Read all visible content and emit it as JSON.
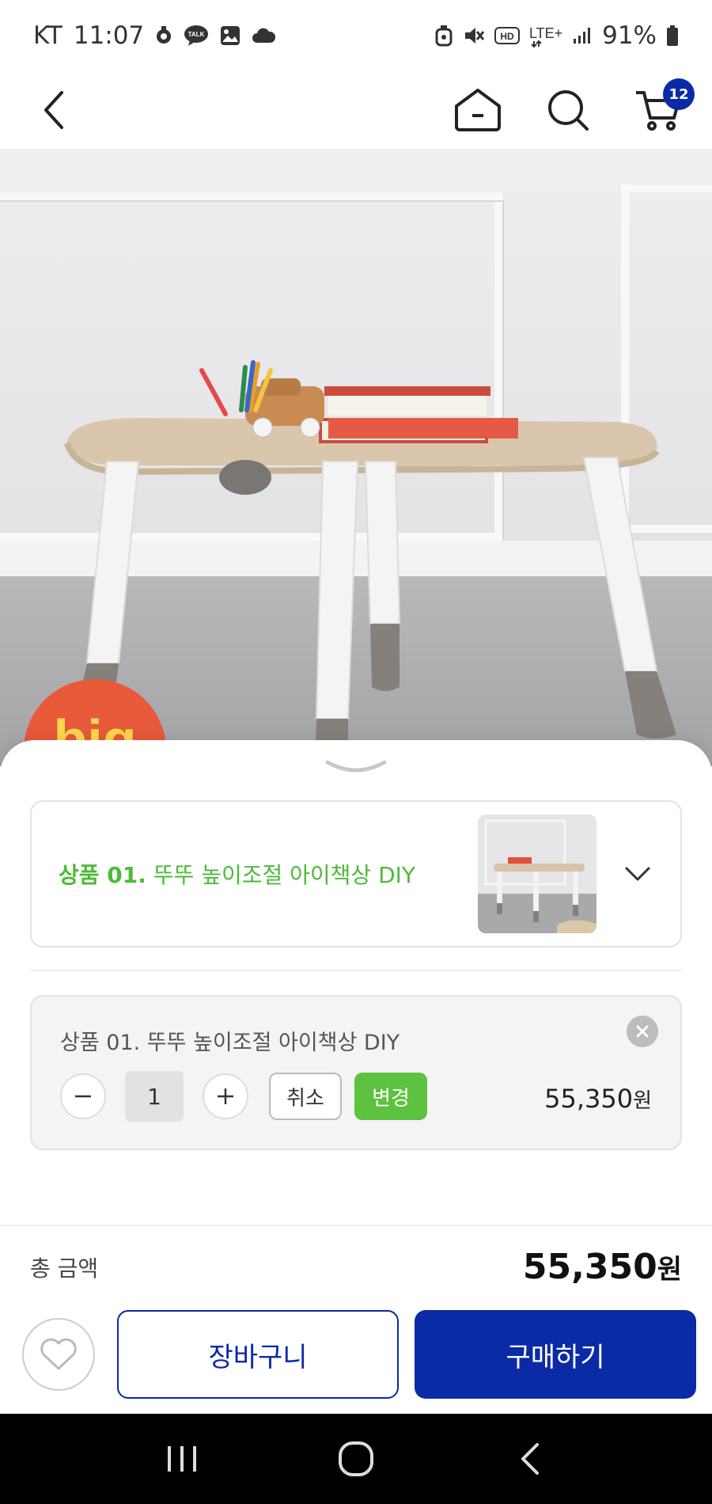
{
  "status_bar": {
    "carrier": "KT",
    "time": "11:07",
    "talk_label": "TALK",
    "hd_label": "HD",
    "network": "LTE+",
    "battery": "91%"
  },
  "header": {
    "cart_count": "12"
  },
  "hero": {
    "badge_text": "big"
  },
  "selected_product": {
    "prefix": "상품 01.",
    "name": "뚜뚜 높이조절 아이책상 DIY"
  },
  "option": {
    "title": "상품 01. 뚜뚜 높이조절 아이책상 DIY",
    "quantity": "1",
    "cancel_label": "취소",
    "change_label": "변경",
    "price": "55,350",
    "currency": "원"
  },
  "total": {
    "label": "총 금액",
    "amount": "55,350",
    "currency": "원"
  },
  "actions": {
    "cart_label": "장바구니",
    "buy_label": "구매하기"
  },
  "colors": {
    "accent_blue": "#0b2aa6",
    "accent_green": "#5cc23f",
    "label_green": "#4dba3a"
  }
}
